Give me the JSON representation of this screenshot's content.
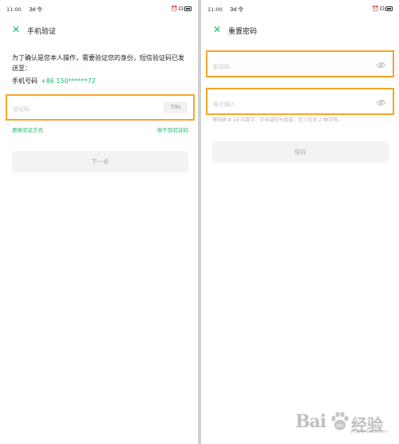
{
  "left_screen": {
    "status": {
      "time": "11:00",
      "signal": "3ııl 令"
    },
    "title": "手机验证",
    "description": "为了确认是您本人操作，需要验证您的身份，短信验证码已发送至：",
    "phone_label": "手机号码",
    "phone_number": "+86 150******72",
    "code_placeholder": "验证码",
    "countdown": "59s",
    "change_method_link": "更换验证方式",
    "no_code_link": "收不到验证码",
    "next_button": "下一步"
  },
  "right_screen": {
    "status": {
      "time": "11:00",
      "signal": "3ııl 令"
    },
    "title": "重置密码",
    "new_password_placeholder": "新密码",
    "confirm_password_placeholder": "再次输入",
    "password_hint": "密码由 8-16 位数字、字母或符号组成，至少包含 2 种字符。",
    "save_button": "保存"
  },
  "watermark": {
    "brand": "Bai",
    "suffix": "经验",
    "url": "jingyan.baidu.com"
  },
  "colors": {
    "accent": "#1fb76a",
    "highlight_border": "#f5a52a",
    "button_disabled": "#f3f3f3"
  },
  "icons": [
    "close-icon",
    "eye-off-icon",
    "headset-icon",
    "battery-icon",
    "wifi-icon"
  ]
}
